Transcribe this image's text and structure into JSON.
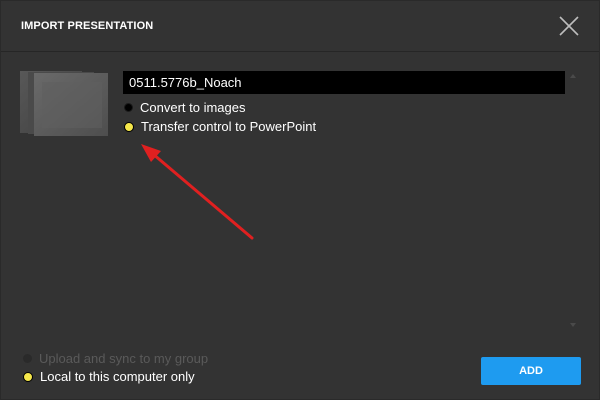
{
  "dialog": {
    "title": "IMPORT PRESENTATION",
    "close_icon": "close-icon"
  },
  "presentation": {
    "name": "0511.5776b_Noach",
    "thumbnail_icon": "presentation-thumbnail"
  },
  "conversion_options": [
    {
      "label": "Convert to images",
      "selected": false
    },
    {
      "label": "Transfer control to PowerPoint",
      "selected": true
    }
  ],
  "storage_options": [
    {
      "label": "Upload and sync to my group",
      "selected": false,
      "disabled": true
    },
    {
      "label": "Local to this computer only",
      "selected": true,
      "disabled": false
    }
  ],
  "actions": {
    "add_label": "ADD"
  },
  "colors": {
    "background": "#333333",
    "accent": "#1e9bf0",
    "radio_selected": "#f5e74b",
    "annotation_arrow": "#e02020"
  }
}
